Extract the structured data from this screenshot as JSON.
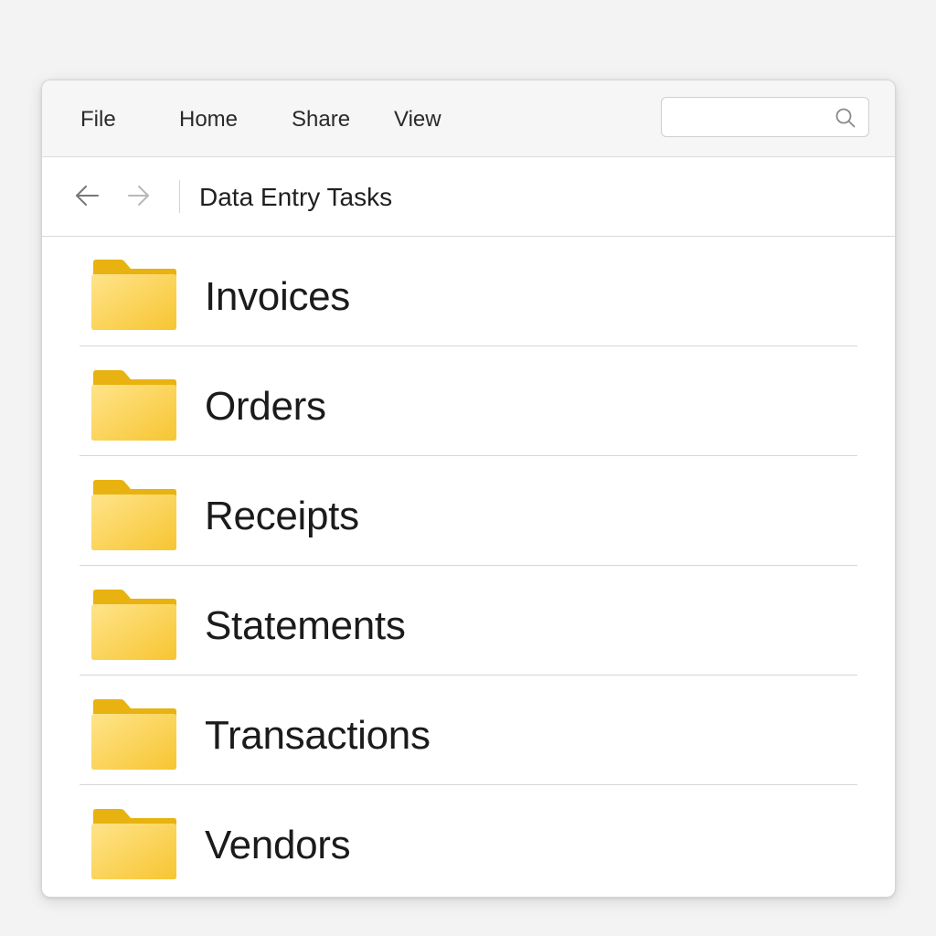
{
  "menu": {
    "file": "File",
    "home": "Home",
    "share": "Share",
    "view": "View"
  },
  "search": {
    "value": "",
    "placeholder": "",
    "icon": "search-icon"
  },
  "navigation": {
    "back_icon": "arrow-left-icon",
    "forward_icon": "arrow-right-icon",
    "breadcrumb": "Data Entry Tasks"
  },
  "folders": [
    {
      "label": "Invoices",
      "icon": "folder-icon"
    },
    {
      "label": "Orders",
      "icon": "folder-icon"
    },
    {
      "label": "Receipts",
      "icon": "folder-icon"
    },
    {
      "label": "Statements",
      "icon": "folder-icon"
    },
    {
      "label": "Transactions",
      "icon": "folder-icon"
    },
    {
      "label": "Vendors",
      "icon": "folder-icon"
    }
  ],
  "colors": {
    "folder_back": "#E9B413",
    "folder_front_light": "#FFE082",
    "folder_front_dark": "#F9C93C"
  }
}
